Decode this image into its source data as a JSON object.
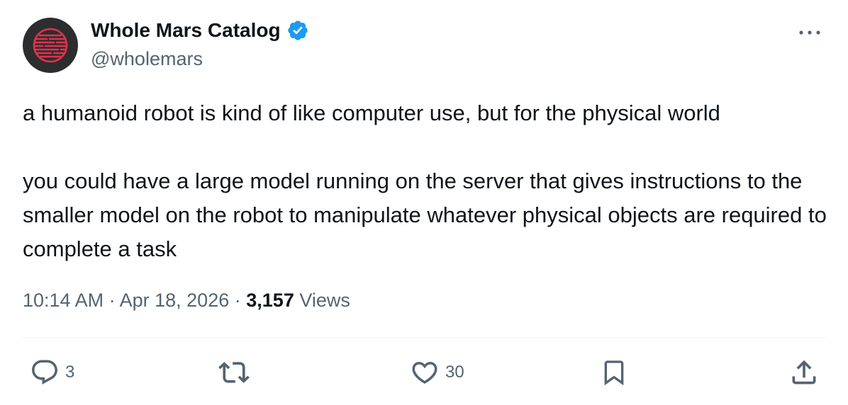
{
  "author": {
    "display_name": "Whole Mars Catalog",
    "handle": "@wholemars",
    "verified": true,
    "avatar_icon": "mars-planet-avatar"
  },
  "tweet": {
    "paragraphs": [
      "a humanoid robot is kind of like computer use, but for the physical world",
      "you could have a large model running on the server that gives instructions to the smaller model on the robot to manipulate whatever physical objects are required to complete a task"
    ],
    "time": "10:14 AM",
    "separator": "·",
    "date": "Apr 18, 2026",
    "views_count": "3,157",
    "views_label": "Views"
  },
  "actions": {
    "reply_count": "3",
    "retweet_count": "",
    "like_count": "30"
  },
  "colors": {
    "text": "#0f1419",
    "secondary": "#536471",
    "verified": "#1d9bf0",
    "avatar_bg": "#2d2d2f",
    "avatar_accent": "#e0334d",
    "divider": "#eff3f4"
  }
}
